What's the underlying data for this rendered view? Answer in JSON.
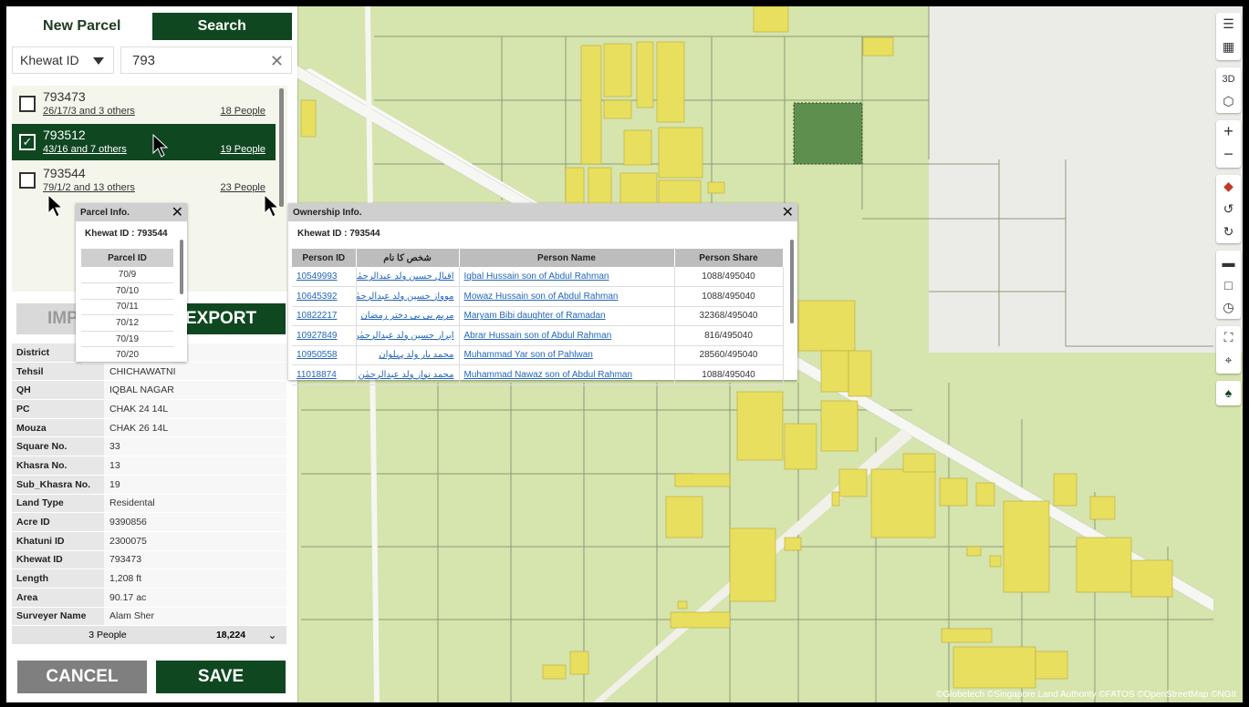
{
  "tabs": {
    "new_parcel": "New Parcel",
    "search": "Search"
  },
  "search": {
    "type_selected": "Khewat ID",
    "query": "793"
  },
  "results": [
    {
      "id": "793473",
      "parcels": "26/17/3 and 3 others",
      "people": "18 People",
      "checked": false
    },
    {
      "id": "793512",
      "parcels": "43/16 and 7 others",
      "people": "19 People",
      "checked": true
    },
    {
      "id": "793544",
      "parcels": "79/1/2 and 13 others",
      "people": "23 People",
      "checked": false
    }
  ],
  "buttons": {
    "import": "IMPORT",
    "export": "EXPORT",
    "cancel": "CANCEL",
    "save": "SAVE"
  },
  "details": [
    {
      "k": "District",
      "v": ""
    },
    {
      "k": "Tehsil",
      "v": "CHICHAWATNI"
    },
    {
      "k": "QH",
      "v": "IQBAL NAGAR"
    },
    {
      "k": "PC",
      "v": "CHAK 24 14L"
    },
    {
      "k": "Mouza",
      "v": "CHAK 26 14L"
    },
    {
      "k": "Square No.",
      "v": "33"
    },
    {
      "k": "Khasra No.",
      "v": "13"
    },
    {
      "k": "Sub_Khasra No.",
      "v": "19"
    },
    {
      "k": "Land Type",
      "v": "Residental"
    },
    {
      "k": "Acre ID",
      "v": "9390856"
    },
    {
      "k": "Khatuni ID",
      "v": "2300075"
    },
    {
      "k": "Khewat ID",
      "v": "793473"
    },
    {
      "k": "Length",
      "v": "1,208 ft"
    },
    {
      "k": "Area",
      "v": "90.17 ac"
    },
    {
      "k": "Surveyer Name",
      "v": "Alam Sher"
    }
  ],
  "footer": {
    "people": "3 People",
    "count": "18,224"
  },
  "parcel_popup": {
    "title": "Parcel Info.",
    "khewat": "Khewat ID : 793544",
    "header": "Parcel ID",
    "rows": [
      "70/9",
      "70/10",
      "70/11",
      "70/12",
      "70/19",
      "70/20"
    ]
  },
  "ownership_popup": {
    "title": "Ownership Info.",
    "khewat": "Khewat ID : 793544",
    "headers": [
      "Person ID",
      "شخص کا نام",
      "Person Name",
      "Person Share"
    ],
    "rows": [
      {
        "pid": "10549993",
        "urdu": "اقبال حسین ولد عبدالرحمٰن",
        "name": "Iqbal Hussain son of Abdul Rahman",
        "share": "1088/495040"
      },
      {
        "pid": "10645392",
        "urdu": "موواز حسین ولد عبدالرحمٰن",
        "name": "Mowaz Hussain son of Abdul Rahman",
        "share": "1088/495040"
      },
      {
        "pid": "10822217",
        "urdu": "مریم بی بی دختر رمضان",
        "name": "Maryam Bibi daughter of Ramadan",
        "share": "32368/495040"
      },
      {
        "pid": "10927849",
        "urdu": "ابرار حسین ولد عبدالرحمٰن",
        "name": "Abrar Hussain son of Abdul Rahman",
        "share": "816/495040"
      },
      {
        "pid": "10950558",
        "urdu": "محمد یار ولد پہلوان",
        "name": "Muhammad Yar son of Pahlwan",
        "share": "28560/495040"
      },
      {
        "pid": "11018874",
        "urdu": "محمد نواز ولد عبدالرحمٰن",
        "name": "Muhammad Nawaz son of Abdul Rahman",
        "share": "1088/495040"
      }
    ]
  },
  "map_controls": {
    "three_d": "3D"
  },
  "attribution": "©Globetech ©Singapore Land Authority ©FATOS ©OpenStreetMap ©NGII",
  "colors": {
    "brand_green": "#0f4720",
    "map_bg": "#d4e3a8",
    "building": "#e8df5e",
    "selected_parcel": "#5e8f4e"
  }
}
